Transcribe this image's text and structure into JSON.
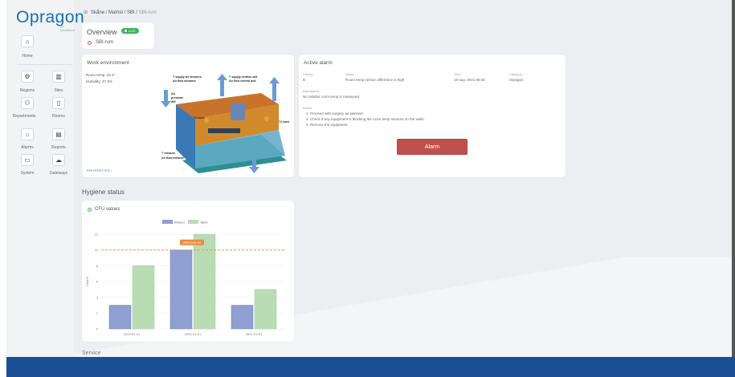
{
  "app": {
    "logo": "Opragon",
    "logo_sub": "by Mediblock"
  },
  "sidebar": {
    "items": [
      {
        "label": "Home",
        "icon": "home-icon"
      },
      {
        "label": "Regions",
        "icon": "regions-icon"
      },
      {
        "label": "Sites",
        "icon": "sites-icon"
      },
      {
        "label": "Departments",
        "icon": "departments-icon"
      },
      {
        "label": "Rooms",
        "icon": "rooms-icon"
      },
      {
        "label": "Alarms",
        "icon": "alarms-icon"
      },
      {
        "label": "Reports",
        "icon": "reports-icon"
      },
      {
        "label": "System",
        "icon": "system-icon"
      },
      {
        "label": "Gateways",
        "icon": "gateways-icon"
      }
    ]
  },
  "breadcrumb": {
    "path": "Skåne / Malmö / SBI / ",
    "current": "SBI-rum"
  },
  "overview": {
    "title": "Overview",
    "live": "LIVE",
    "room": "SBI-rum"
  },
  "work_environment": {
    "title": "Work environment",
    "room_temp": "Room temp. 23.3°",
    "humidity": "Humidity: 47.3%",
    "properties_link": "PROPERTIES",
    "diagram_labels": {
      "supply_showers": "T supply air showers",
      "flow_showers": "Air flow showers",
      "supply_central": "T supply central unit",
      "flow_central": "Air flow central unit",
      "air": "Air",
      "pressure": "pressure",
      "diff": "diff",
      "t1_room": "T1 room",
      "t2_room": "T2 room",
      "t_exhaust": "T exhaust",
      "flow_exhaust": "Air flow exhaust"
    }
  },
  "active_alarm": {
    "title": "Active alarm",
    "headers": {
      "priority": "Priority",
      "alarm": "Alarm",
      "time": "Time",
      "category": "Category"
    },
    "priority": "B",
    "alarm": "Room temp sensor difference is high",
    "time": "19 aug. 2021 09:30",
    "category": "Opragon",
    "description_label": "Description",
    "description": "No reliable room temp is measured.",
    "action_label": "Action",
    "actions": [
      "1. Proceed with surgery as planned.",
      "2. Check if any equipment is blocking the room temp sensors on the walls.",
      "3. Remove the equipment."
    ],
    "button": "Alarm"
  },
  "hygiene": {
    "section_title": "Hygiene status",
    "card_title": "CFU values",
    "chart_data": {
      "type": "bar",
      "categories": [
        "2019-01-01",
        "2020-01-01",
        "2021-01-01"
      ],
      "series": [
        {
          "name": "Wound",
          "values": [
            3,
            10,
            3
          ],
          "color": "#8f9fd1"
        },
        {
          "name": "Table",
          "values": [
            8,
            12,
            5
          ],
          "color": "#b9dcb5"
        }
      ],
      "ylabel": "Cfu/m³",
      "ylim": [
        0,
        12
      ],
      "yticks": [
        "0",
        "2",
        "4",
        "6",
        "8",
        "10",
        "12"
      ],
      "threshold": {
        "value": 10,
        "label": "Ultra clean air",
        "color": "#f08a3c"
      },
      "legend_position": "top"
    }
  },
  "service": {
    "title": "Service"
  }
}
